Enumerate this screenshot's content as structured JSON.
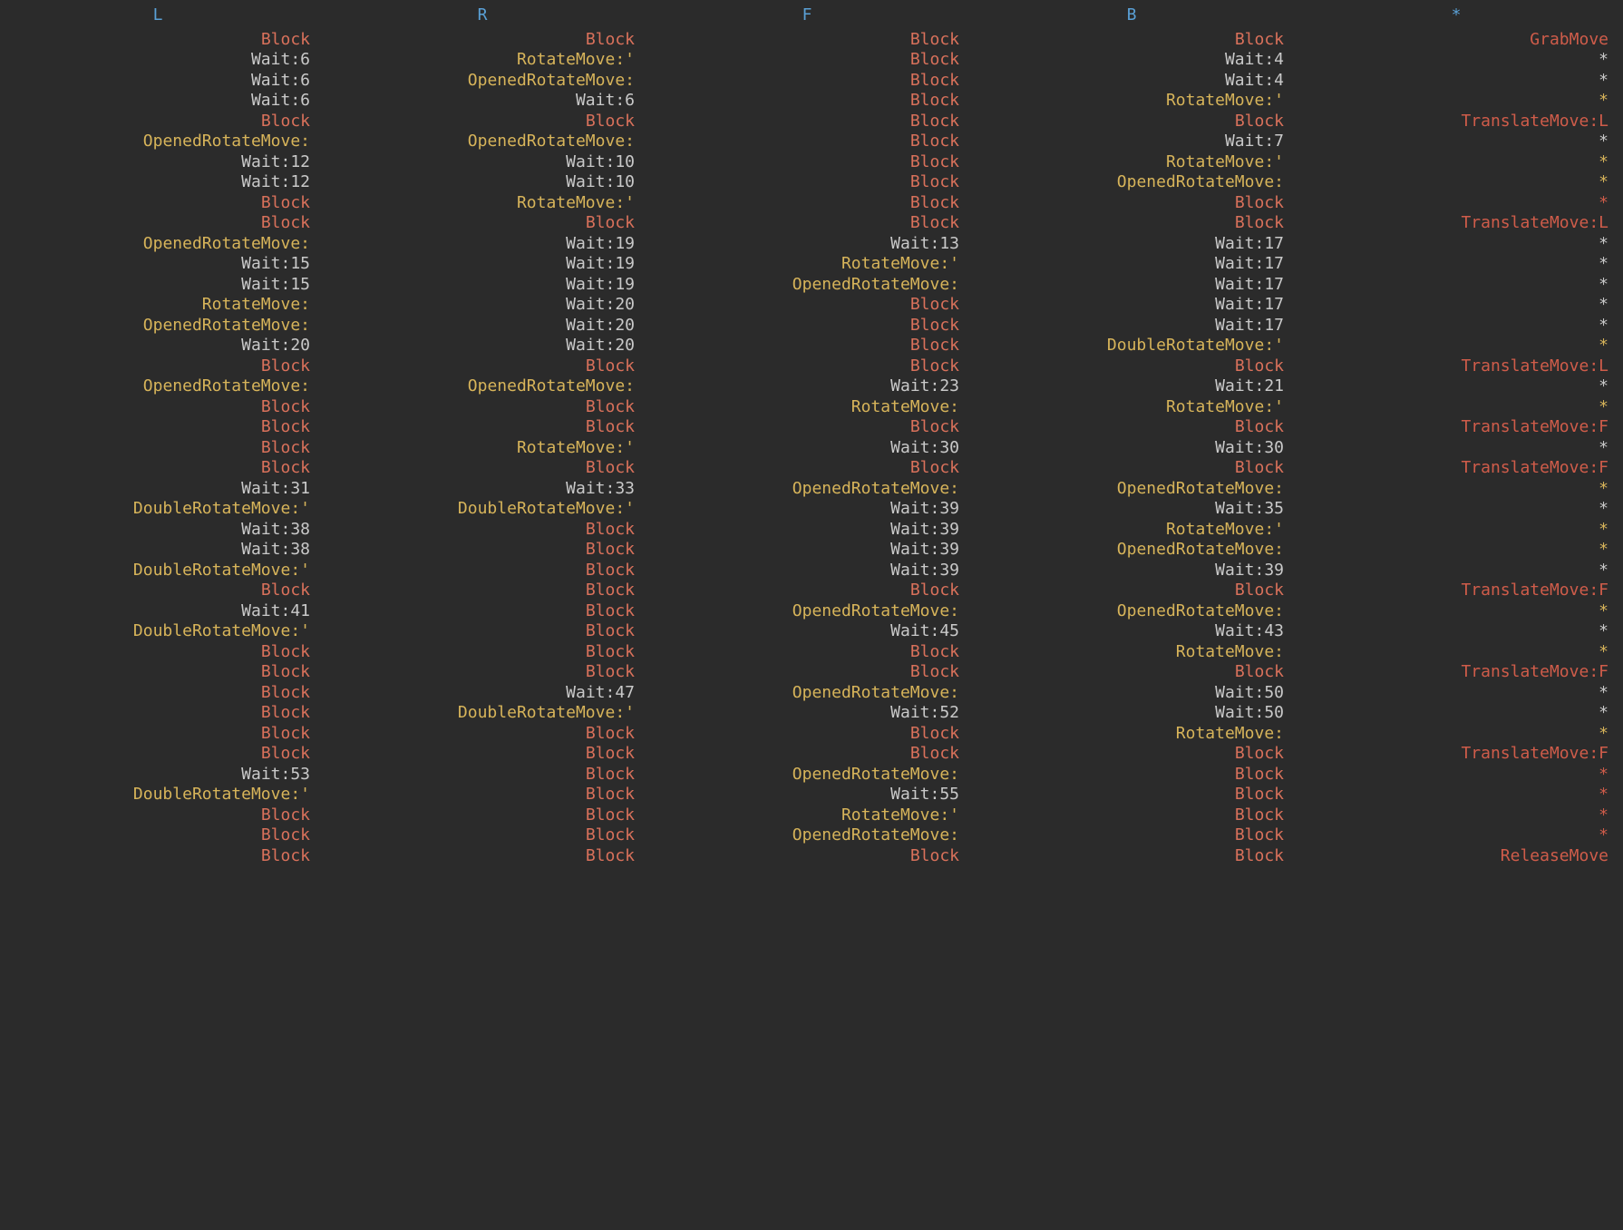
{
  "colors": {
    "header": "c-hdr",
    "block": "c-block",
    "white": "c-white",
    "gold": "c-gold",
    "red": "c-red"
  },
  "columns": [
    {
      "header": "L",
      "cells": [
        {
          "text": "Block",
          "c": "block"
        },
        {
          "text": "Wait:6",
          "c": "white"
        },
        {
          "text": "Wait:6",
          "c": "white"
        },
        {
          "text": "Wait:6",
          "c": "white"
        },
        {
          "text": "Block",
          "c": "block"
        },
        {
          "text": "OpenedRotateMove:",
          "c": "gold"
        },
        {
          "text": "Wait:12",
          "c": "white"
        },
        {
          "text": "Wait:12",
          "c": "white"
        },
        {
          "text": "Block",
          "c": "block"
        },
        {
          "text": "Block",
          "c": "block"
        },
        {
          "text": "OpenedRotateMove:",
          "c": "gold"
        },
        {
          "text": "Wait:15",
          "c": "white"
        },
        {
          "text": "Wait:15",
          "c": "white"
        },
        {
          "text": "RotateMove:",
          "c": "gold"
        },
        {
          "text": "OpenedRotateMove:",
          "c": "gold"
        },
        {
          "text": "Wait:20",
          "c": "white"
        },
        {
          "text": "Block",
          "c": "block"
        },
        {
          "text": "OpenedRotateMove:",
          "c": "gold"
        },
        {
          "text": "Block",
          "c": "block"
        },
        {
          "text": "Block",
          "c": "block"
        },
        {
          "text": "Block",
          "c": "block"
        },
        {
          "text": "Block",
          "c": "block"
        },
        {
          "text": "Wait:31",
          "c": "white"
        },
        {
          "text": "DoubleRotateMove:'",
          "c": "gold"
        },
        {
          "text": "Wait:38",
          "c": "white"
        },
        {
          "text": "Wait:38",
          "c": "white"
        },
        {
          "text": "DoubleRotateMove:'",
          "c": "gold"
        },
        {
          "text": "Block",
          "c": "block"
        },
        {
          "text": "Wait:41",
          "c": "white"
        },
        {
          "text": "DoubleRotateMove:'",
          "c": "gold"
        },
        {
          "text": "Block",
          "c": "block"
        },
        {
          "text": "Block",
          "c": "block"
        },
        {
          "text": "Block",
          "c": "block"
        },
        {
          "text": "Block",
          "c": "block"
        },
        {
          "text": "Block",
          "c": "block"
        },
        {
          "text": "Block",
          "c": "block"
        },
        {
          "text": "Wait:53",
          "c": "white"
        },
        {
          "text": "DoubleRotateMove:'",
          "c": "gold"
        },
        {
          "text": "Block",
          "c": "block"
        },
        {
          "text": "Block",
          "c": "block"
        },
        {
          "text": "Block",
          "c": "block"
        }
      ]
    },
    {
      "header": "R",
      "cells": [
        {
          "text": "Block",
          "c": "block"
        },
        {
          "text": "RotateMove:'",
          "c": "gold"
        },
        {
          "text": "OpenedRotateMove:",
          "c": "gold"
        },
        {
          "text": "Wait:6",
          "c": "white"
        },
        {
          "text": "Block",
          "c": "block"
        },
        {
          "text": "OpenedRotateMove:",
          "c": "gold"
        },
        {
          "text": "Wait:10",
          "c": "white"
        },
        {
          "text": "Wait:10",
          "c": "white"
        },
        {
          "text": "RotateMove:'",
          "c": "gold"
        },
        {
          "text": "Block",
          "c": "block"
        },
        {
          "text": "Wait:19",
          "c": "white"
        },
        {
          "text": "Wait:19",
          "c": "white"
        },
        {
          "text": "Wait:19",
          "c": "white"
        },
        {
          "text": "Wait:20",
          "c": "white"
        },
        {
          "text": "Wait:20",
          "c": "white"
        },
        {
          "text": "Wait:20",
          "c": "white"
        },
        {
          "text": "Block",
          "c": "block"
        },
        {
          "text": "OpenedRotateMove:",
          "c": "gold"
        },
        {
          "text": "Block",
          "c": "block"
        },
        {
          "text": "Block",
          "c": "block"
        },
        {
          "text": "RotateMove:'",
          "c": "gold"
        },
        {
          "text": "Block",
          "c": "block"
        },
        {
          "text": "Wait:33",
          "c": "white"
        },
        {
          "text": "DoubleRotateMove:'",
          "c": "gold"
        },
        {
          "text": "Block",
          "c": "block"
        },
        {
          "text": "Block",
          "c": "block"
        },
        {
          "text": "Block",
          "c": "block"
        },
        {
          "text": "Block",
          "c": "block"
        },
        {
          "text": "Block",
          "c": "block"
        },
        {
          "text": "Block",
          "c": "block"
        },
        {
          "text": "Block",
          "c": "block"
        },
        {
          "text": "Block",
          "c": "block"
        },
        {
          "text": "Wait:47",
          "c": "white"
        },
        {
          "text": "DoubleRotateMove:'",
          "c": "gold"
        },
        {
          "text": "Block",
          "c": "block"
        },
        {
          "text": "Block",
          "c": "block"
        },
        {
          "text": "Block",
          "c": "block"
        },
        {
          "text": "Block",
          "c": "block"
        },
        {
          "text": "Block",
          "c": "block"
        },
        {
          "text": "Block",
          "c": "block"
        },
        {
          "text": "Block",
          "c": "block"
        }
      ]
    },
    {
      "header": "F",
      "cells": [
        {
          "text": "Block",
          "c": "block"
        },
        {
          "text": "Block",
          "c": "block"
        },
        {
          "text": "Block",
          "c": "block"
        },
        {
          "text": "Block",
          "c": "block"
        },
        {
          "text": "Block",
          "c": "block"
        },
        {
          "text": "Block",
          "c": "block"
        },
        {
          "text": "Block",
          "c": "block"
        },
        {
          "text": "Block",
          "c": "block"
        },
        {
          "text": "Block",
          "c": "block"
        },
        {
          "text": "Block",
          "c": "block"
        },
        {
          "text": "Wait:13",
          "c": "white"
        },
        {
          "text": "RotateMove:'",
          "c": "gold"
        },
        {
          "text": "OpenedRotateMove:",
          "c": "gold"
        },
        {
          "text": "Block",
          "c": "block"
        },
        {
          "text": "Block",
          "c": "block"
        },
        {
          "text": "Block",
          "c": "block"
        },
        {
          "text": "Block",
          "c": "block"
        },
        {
          "text": "Wait:23",
          "c": "white"
        },
        {
          "text": "RotateMove:",
          "c": "gold"
        },
        {
          "text": "Block",
          "c": "block"
        },
        {
          "text": "Wait:30",
          "c": "white"
        },
        {
          "text": "Block",
          "c": "block"
        },
        {
          "text": "OpenedRotateMove:",
          "c": "gold"
        },
        {
          "text": "Wait:39",
          "c": "white"
        },
        {
          "text": "Wait:39",
          "c": "white"
        },
        {
          "text": "Wait:39",
          "c": "white"
        },
        {
          "text": "Wait:39",
          "c": "white"
        },
        {
          "text": "Block",
          "c": "block"
        },
        {
          "text": "OpenedRotateMove:",
          "c": "gold"
        },
        {
          "text": "Wait:45",
          "c": "white"
        },
        {
          "text": "Block",
          "c": "block"
        },
        {
          "text": "Block",
          "c": "block"
        },
        {
          "text": "OpenedRotateMove:",
          "c": "gold"
        },
        {
          "text": "Wait:52",
          "c": "white"
        },
        {
          "text": "Block",
          "c": "block"
        },
        {
          "text": "Block",
          "c": "block"
        },
        {
          "text": "OpenedRotateMove:",
          "c": "gold"
        },
        {
          "text": "Wait:55",
          "c": "white"
        },
        {
          "text": "RotateMove:'",
          "c": "gold"
        },
        {
          "text": "OpenedRotateMove:",
          "c": "gold"
        },
        {
          "text": "Block",
          "c": "block"
        }
      ]
    },
    {
      "header": "B",
      "cells": [
        {
          "text": "Block",
          "c": "block"
        },
        {
          "text": "Wait:4",
          "c": "white"
        },
        {
          "text": "Wait:4",
          "c": "white"
        },
        {
          "text": "RotateMove:'",
          "c": "gold"
        },
        {
          "text": "Block",
          "c": "block"
        },
        {
          "text": "Wait:7",
          "c": "white"
        },
        {
          "text": "RotateMove:'",
          "c": "gold"
        },
        {
          "text": "OpenedRotateMove:",
          "c": "gold"
        },
        {
          "text": "Block",
          "c": "block"
        },
        {
          "text": "Block",
          "c": "block"
        },
        {
          "text": "Wait:17",
          "c": "white"
        },
        {
          "text": "Wait:17",
          "c": "white"
        },
        {
          "text": "Wait:17",
          "c": "white"
        },
        {
          "text": "Wait:17",
          "c": "white"
        },
        {
          "text": "Wait:17",
          "c": "white"
        },
        {
          "text": "DoubleRotateMove:'",
          "c": "gold"
        },
        {
          "text": "Block",
          "c": "block"
        },
        {
          "text": "Wait:21",
          "c": "white"
        },
        {
          "text": "RotateMove:'",
          "c": "gold"
        },
        {
          "text": "Block",
          "c": "block"
        },
        {
          "text": "Wait:30",
          "c": "white"
        },
        {
          "text": "Block",
          "c": "block"
        },
        {
          "text": "OpenedRotateMove:",
          "c": "gold"
        },
        {
          "text": "Wait:35",
          "c": "white"
        },
        {
          "text": "RotateMove:'",
          "c": "gold"
        },
        {
          "text": "OpenedRotateMove:",
          "c": "gold"
        },
        {
          "text": "Wait:39",
          "c": "white"
        },
        {
          "text": "Block",
          "c": "block"
        },
        {
          "text": "OpenedRotateMove:",
          "c": "gold"
        },
        {
          "text": "Wait:43",
          "c": "white"
        },
        {
          "text": "RotateMove:",
          "c": "gold"
        },
        {
          "text": "Block",
          "c": "block"
        },
        {
          "text": "Wait:50",
          "c": "white"
        },
        {
          "text": "Wait:50",
          "c": "white"
        },
        {
          "text": "RotateMove:",
          "c": "gold"
        },
        {
          "text": "Block",
          "c": "block"
        },
        {
          "text": "Block",
          "c": "block"
        },
        {
          "text": "Block",
          "c": "block"
        },
        {
          "text": "Block",
          "c": "block"
        },
        {
          "text": "Block",
          "c": "block"
        },
        {
          "text": "Block",
          "c": "block"
        }
      ]
    },
    {
      "header": "*",
      "cells": [
        {
          "text": "GrabMove",
          "c": "red"
        },
        {
          "text": "*",
          "c": "white"
        },
        {
          "text": "*",
          "c": "white"
        },
        {
          "text": "*",
          "c": "gold"
        },
        {
          "text": "TranslateMove:L",
          "c": "red"
        },
        {
          "text": "*",
          "c": "white"
        },
        {
          "text": "*",
          "c": "gold"
        },
        {
          "text": "*",
          "c": "gold"
        },
        {
          "text": "*",
          "c": "red"
        },
        {
          "text": "TranslateMove:L",
          "c": "red"
        },
        {
          "text": "*",
          "c": "white"
        },
        {
          "text": "*",
          "c": "white"
        },
        {
          "text": "*",
          "c": "white"
        },
        {
          "text": "*",
          "c": "white"
        },
        {
          "text": "*",
          "c": "white"
        },
        {
          "text": "*",
          "c": "gold"
        },
        {
          "text": "TranslateMove:L",
          "c": "red"
        },
        {
          "text": "*",
          "c": "white"
        },
        {
          "text": "*",
          "c": "gold"
        },
        {
          "text": "TranslateMove:F",
          "c": "red"
        },
        {
          "text": "*",
          "c": "white"
        },
        {
          "text": "TranslateMove:F",
          "c": "red"
        },
        {
          "text": "*",
          "c": "gold"
        },
        {
          "text": "*",
          "c": "white"
        },
        {
          "text": "*",
          "c": "gold"
        },
        {
          "text": "*",
          "c": "gold"
        },
        {
          "text": "*",
          "c": "white"
        },
        {
          "text": "TranslateMove:F",
          "c": "red"
        },
        {
          "text": "*",
          "c": "gold"
        },
        {
          "text": "*",
          "c": "white"
        },
        {
          "text": "*",
          "c": "gold"
        },
        {
          "text": "TranslateMove:F",
          "c": "red"
        },
        {
          "text": "*",
          "c": "white"
        },
        {
          "text": "*",
          "c": "white"
        },
        {
          "text": "*",
          "c": "gold"
        },
        {
          "text": "TranslateMove:F",
          "c": "red"
        },
        {
          "text": "*",
          "c": "red"
        },
        {
          "text": "*",
          "c": "red"
        },
        {
          "text": "*",
          "c": "red"
        },
        {
          "text": "*",
          "c": "red"
        },
        {
          "text": "ReleaseMove",
          "c": "red"
        }
      ]
    }
  ]
}
